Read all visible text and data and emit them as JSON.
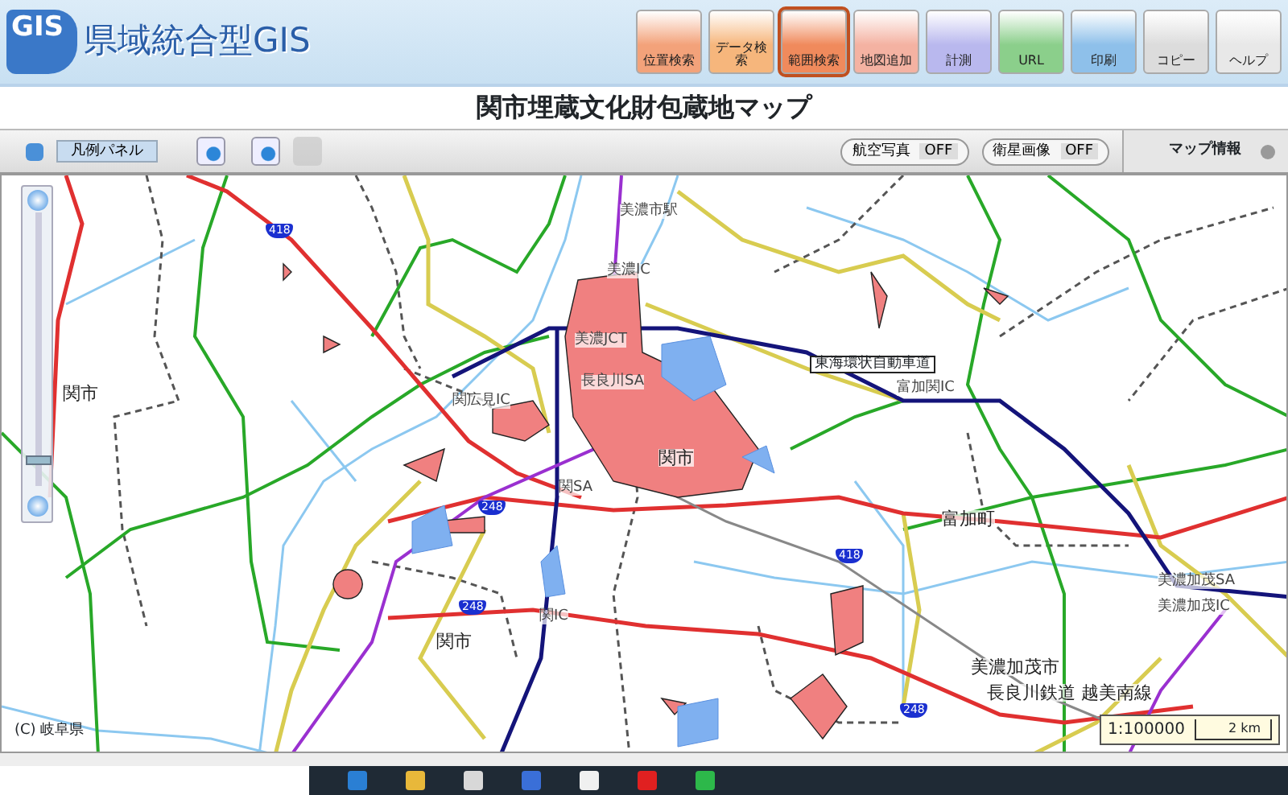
{
  "header": {
    "logo": "GIS",
    "title": "県域統合型GIS"
  },
  "tools": [
    {
      "label": "位置検索",
      "color": "#f3a27a",
      "selected": false
    },
    {
      "label": "データ検索",
      "color": "#f6b67c",
      "selected": false
    },
    {
      "label": "範囲検索",
      "color": "#f08a5c",
      "selected": true
    },
    {
      "label": "地図追加",
      "color": "#f4b2a2",
      "selected": false
    },
    {
      "label": "計測",
      "color": "#b9b8ee",
      "selected": false
    },
    {
      "label": "URL",
      "color": "#8bcf8b",
      "selected": false
    },
    {
      "label": "印刷",
      "color": "#8ec0ea",
      "selected": false
    },
    {
      "label": "コピー",
      "color": "#dcdcdc",
      "selected": false
    },
    {
      "label": "ヘルプ",
      "color": "#e8e8e8",
      "selected": false
    }
  ],
  "map_title": "関市埋蔵文化財包蔵地マップ",
  "legend_button": "凡例パネル",
  "pan_tool": {
    "disabled": true
  },
  "layer_toggles": [
    {
      "label": "航空写真",
      "state": "OFF",
      "on": false
    },
    {
      "label": "衛星画像",
      "state": "OFF",
      "on": false
    }
  ],
  "info_tab": "マップ情報",
  "zoom": {
    "level": 0.08
  },
  "map": {
    "labels": [
      {
        "text": "美濃市駅",
        "kind": "facility"
      },
      {
        "text": "美濃IC",
        "kind": "facility"
      },
      {
        "text": "美濃JCT",
        "kind": "facility"
      },
      {
        "text": "関市",
        "kind": "place"
      },
      {
        "text": "長良川SA",
        "kind": "facility"
      },
      {
        "text": "関広見IC",
        "kind": "facility"
      },
      {
        "text": "東海環状自動車道",
        "kind": "road"
      },
      {
        "text": "富加関IC",
        "kind": "facility"
      },
      {
        "text": "関市",
        "kind": "place"
      },
      {
        "text": "関SA",
        "kind": "facility"
      },
      {
        "text": "関IC",
        "kind": "facility"
      },
      {
        "text": "関市",
        "kind": "place"
      },
      {
        "text": "富加町",
        "kind": "place"
      },
      {
        "text": "美濃加茂SA",
        "kind": "facility"
      },
      {
        "text": "美濃加茂IC",
        "kind": "facility"
      },
      {
        "text": "美濃加茂市",
        "kind": "place"
      },
      {
        "text": "長良川鉄道 越美南線",
        "kind": "place"
      }
    ],
    "route_shields": [
      "418",
      "418",
      "248",
      "248",
      "248"
    ],
    "copyright": "(C) 岐阜県",
    "scale": "1:100000",
    "scale_bar": "2 km"
  }
}
